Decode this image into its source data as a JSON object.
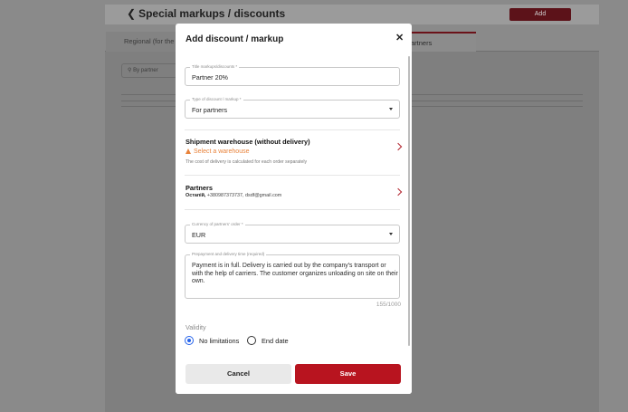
{
  "background": {
    "page_title": "Special markups / discounts",
    "add_button": "Add",
    "tab_left": "Regional (for the",
    "tab_right": "artners",
    "search_placeholder": "By partner"
  },
  "modal": {
    "title": "Add discount / markup",
    "close_icon": "close-icon",
    "title_field": {
      "legend": "Title markups/discounts *",
      "value": "Partner 20%"
    },
    "type_field": {
      "legend": "Type of discount / markup *",
      "value": "For partners"
    },
    "warehouse": {
      "title": "Shipment warehouse (without delivery)",
      "warning": "Select a warehouse",
      "hint": "The cost of delivery is calculated for each order separately"
    },
    "partners": {
      "title": "Partners",
      "name": "Остапій,",
      "details": " +380987373737, dsdf@gmail.com"
    },
    "currency_field": {
      "legend": "Currency of partners' order *",
      "value": "EUR"
    },
    "prepayment_field": {
      "legend": "Prepayment and delivery time (required)",
      "value": "Payment is in full. Delivery is carried out by the company's transport or with the help of carriers. The customer organizes unloading on site on their own.",
      "counter": "155/1000"
    },
    "validity": {
      "label": "Validity",
      "options": [
        {
          "label": "No limitations",
          "checked": true
        },
        {
          "label": "End date",
          "checked": false
        }
      ]
    },
    "buttons": {
      "cancel": "Cancel",
      "save": "Save"
    }
  },
  "colors": {
    "accent": "#b8141f",
    "warning": "#e8823a",
    "radio_checked": "#2563eb"
  }
}
